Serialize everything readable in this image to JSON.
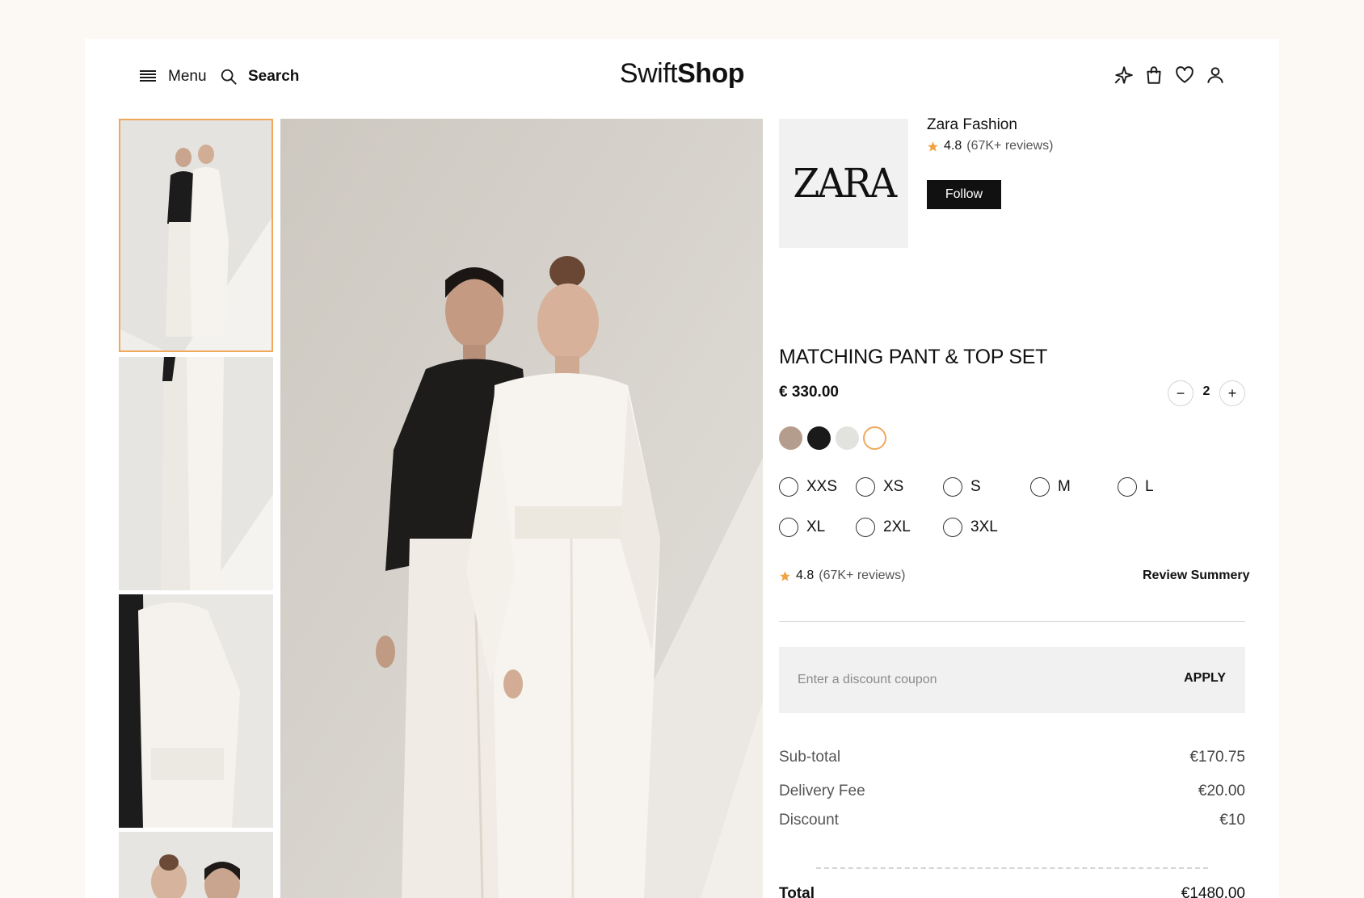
{
  "header": {
    "menu_label": "Menu",
    "search_label": "Search",
    "logo_light": "Swift",
    "logo_bold": "Shop"
  },
  "brand": {
    "logo_text": "ZARA",
    "name": "Zara Fashion",
    "rating": "4.8",
    "reviews": "(67K+ reviews)",
    "follow_label": "Follow"
  },
  "product": {
    "title": "MATCHING PANT & TOP SET",
    "price": "€ 330.00",
    "quantity": "2",
    "qty_minus": "−",
    "qty_plus": "+",
    "colors": [
      {
        "name": "taupe",
        "hex": "#b49d8c"
      },
      {
        "name": "black",
        "hex": "#1a1a1a"
      },
      {
        "name": "light-grey",
        "hex": "#e2e2de"
      },
      {
        "name": "white",
        "hex": "#ffffff",
        "selected": true
      }
    ],
    "sizes": [
      "XXS",
      "XS",
      "S",
      "M",
      "L",
      "XL",
      "2XL",
      "3XL"
    ],
    "rating": "4.8",
    "reviews": "(67K+ reviews)",
    "review_summary_label": "Review Summery"
  },
  "coupon": {
    "placeholder": "Enter a discount coupon",
    "apply_label": "APPLY"
  },
  "summary": {
    "subtotal_label": "Sub-total",
    "subtotal_value": "€170.75",
    "delivery_label": "Delivery Fee",
    "delivery_value": "€20.00",
    "discount_label": "Discount",
    "discount_value": "€10",
    "total_label": "Total",
    "total_value": "€1480.00"
  },
  "colors": {
    "accent": "#f0a85a",
    "star": "#f2a344",
    "dark": "#111111"
  }
}
